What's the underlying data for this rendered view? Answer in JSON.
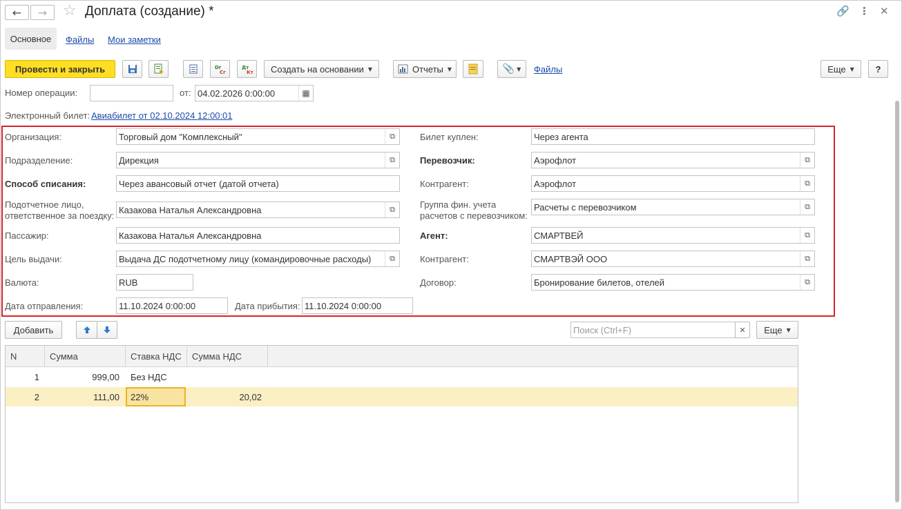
{
  "window": {
    "title": "Доплата (создание) *"
  },
  "tabs": [
    {
      "label": "Основное"
    },
    {
      "label": "Файлы"
    },
    {
      "label": "Мои заметки"
    }
  ],
  "toolbar": {
    "post_close": "Провести и закрыть",
    "create_based": "Создать на основании",
    "reports": "Отчеты",
    "files_link": "Файлы",
    "more": "Еще",
    "help": "?"
  },
  "header": {
    "op_number_label": "Номер операции:",
    "op_number_value": "",
    "from_label": "от:",
    "from_value": "04.02.2026  0:00:00",
    "eticket_label": "Электронный билет:",
    "eticket_link": "Авиабилет  от 02.10.2024 12:00:01"
  },
  "form_left": {
    "org_label": "Организация:",
    "org_value": "Торговый дом \"Комплексный\"",
    "dept_label": "Подразделение:",
    "dept_value": "Дирекция",
    "method_label": "Способ списания:",
    "method_value": "Через авансовый отчет (датой отчета)",
    "person_label_1": "Подотчетное лицо,",
    "person_label_2": "ответственное за поездку:",
    "person_value": "Казакова Наталья Александровна",
    "passenger_label": "Пассажир:",
    "passenger_value": "Казакова Наталья Александровна",
    "purpose_label": "Цель выдачи:",
    "purpose_value": "Выдача ДС подотчетному лицу (командировочные расходы)",
    "currency_label": "Валюта:",
    "currency_value": "RUB",
    "depart_label": "Дата отправления:",
    "depart_value": "11.10.2024  0:00:00",
    "arrive_label": "Дата прибытия:",
    "arrive_value": "11.10.2024  0:00:00"
  },
  "form_right": {
    "bought_label": "Билет куплен:",
    "bought_value": "Через агента",
    "carrier_label": "Перевозчик:",
    "carrier_value": "Аэрофлот",
    "contractor1_label": "Контрагент:",
    "contractor1_value": "Аэрофлот",
    "fingroup_label_1": "Группа фин. учета",
    "fingroup_label_2": "расчетов с перевозчиком:",
    "fingroup_value": "Расчеты с перевозчиком",
    "agent_label": "Агент:",
    "agent_value": "СМАРТВЕЙ",
    "contractor2_label": "Контрагент:",
    "contractor2_value": "СМАРТВЭЙ ООО",
    "contract_label": "Договор:",
    "contract_value": "Бронирование билетов, отелей"
  },
  "table_toolbar": {
    "add": "Добавить",
    "search_placeholder": "Поиск (Ctrl+F)",
    "more": "Еще"
  },
  "table": {
    "columns": [
      "N",
      "Сумма",
      "Ставка НДС",
      "Сумма НДС"
    ],
    "rows": [
      {
        "n": "1",
        "sum": "999,00",
        "rate": "Без НДС",
        "vat": ""
      },
      {
        "n": "2",
        "sum": "111,00",
        "rate": "22%",
        "vat": "20,02"
      }
    ]
  },
  "colors": {
    "primary_button": "#ffde24",
    "highlight_box": "#d4242c",
    "selected_row": "#fbf0c4",
    "link": "#1a4aa8"
  }
}
